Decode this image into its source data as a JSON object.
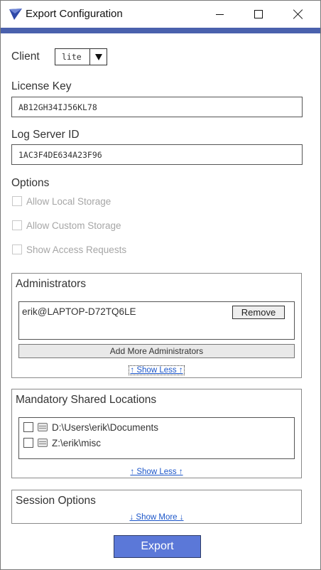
{
  "window": {
    "title": "Export Configuration",
    "accent_color": "#4a61ad"
  },
  "client": {
    "label": "Client",
    "selected": "lite"
  },
  "license_key": {
    "label": "License Key",
    "value": "AB12GH34IJ56KL78"
  },
  "log_server": {
    "label": "Log Server ID",
    "value": "1AC3F4DE634A23F96"
  },
  "options": {
    "label": "Options",
    "items": [
      {
        "label": "Allow Local Storage",
        "checked": false,
        "enabled": false
      },
      {
        "label": "Allow Custom Storage",
        "checked": false,
        "enabled": false
      },
      {
        "label": "Show Access Requests",
        "checked": false,
        "enabled": false
      }
    ]
  },
  "administrators": {
    "title": "Administrators",
    "entries": [
      {
        "name": "erik@LAPTOP-D72TQ6LE",
        "remove_label": "Remove"
      }
    ],
    "add_label": "Add More Administrators",
    "toggle_label": "↑ Show Less ↑"
  },
  "shared_locations": {
    "title": "Mandatory Shared Locations",
    "items": [
      {
        "path": "D:\\Users\\erik\\Documents",
        "checked": false
      },
      {
        "path": "Z:\\erik\\misc",
        "checked": false
      }
    ],
    "toggle_label": "↑ Show Less ↑"
  },
  "session_options": {
    "title": "Session Options",
    "toggle_label": "↓ Show More ↓"
  },
  "export": {
    "label": "Export",
    "color": "#5b78d8"
  }
}
